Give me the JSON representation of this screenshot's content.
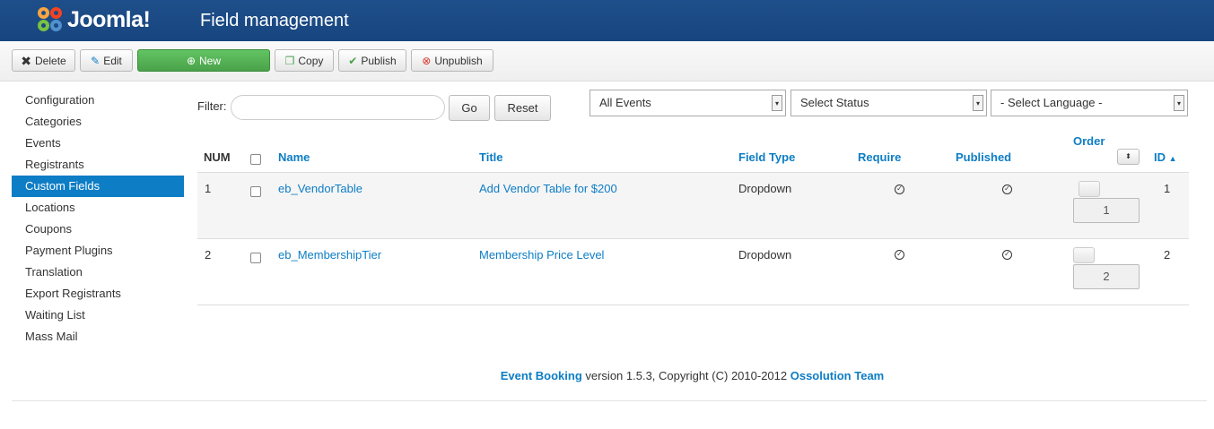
{
  "header": {
    "brand": "Joomla!",
    "title": "Field management"
  },
  "toolbar": {
    "delete": "Delete",
    "edit": "Edit",
    "new": "New",
    "copy": "Copy",
    "publish": "Publish",
    "unpublish": "Unpublish"
  },
  "sidebar": {
    "items": [
      "Configuration",
      "Categories",
      "Events",
      "Registrants",
      "Custom Fields",
      "Locations",
      "Coupons",
      "Payment Plugins",
      "Translation",
      "Export Registrants",
      "Waiting List",
      "Mass Mail"
    ],
    "active": "Custom Fields"
  },
  "filters": {
    "label": "Filter:",
    "value": "",
    "go": "Go",
    "reset": "Reset",
    "events": "All Events",
    "status": "Select Status",
    "language": "- Select Language -"
  },
  "table": {
    "headers": {
      "num": "NUM",
      "name": "Name",
      "title": "Title",
      "field_type": "Field Type",
      "require": "Require",
      "published": "Published",
      "order": "Order",
      "id": "ID"
    },
    "rows": [
      {
        "num": "1",
        "name": "eb_VendorTable",
        "title": "Add Vendor Table for $200",
        "field_type": "Dropdown",
        "require": true,
        "published": true,
        "order": "1",
        "id": "1"
      },
      {
        "num": "2",
        "name": "eb_MembershipTier",
        "title": "Membership Price Level",
        "field_type": "Dropdown",
        "require": true,
        "published": true,
        "order": "2",
        "id": "2"
      }
    ]
  },
  "footer": {
    "product": "Event Booking",
    "text": " version 1.5.3, Copyright (C) 2010-2012 ",
    "team": "Ossolution Team"
  },
  "colors": {
    "header": "#17457f",
    "accent": "#0d7dc5",
    "new_button": "#4aa24a"
  }
}
